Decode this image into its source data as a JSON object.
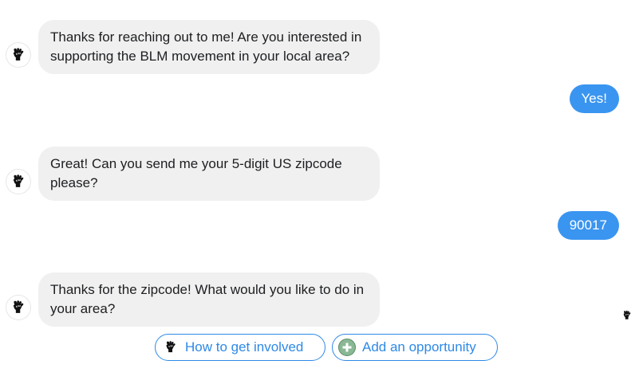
{
  "messages": [
    {
      "from": "bot",
      "text": "Thanks for reaching out to me! Are you interested in supporting the BLM movement in your local area?"
    },
    {
      "from": "user",
      "text": "Yes!"
    },
    {
      "from": "bot",
      "text": "Great! Can you send me your 5-digit US zipcode please?"
    },
    {
      "from": "user",
      "text": "90017"
    },
    {
      "from": "bot",
      "text": "Thanks for the zipcode! What would you like to do in your area?"
    }
  ],
  "quick_replies": [
    {
      "label": "How to get involved",
      "icon": "raised-fist-icon"
    },
    {
      "label": "Add an opportunity",
      "icon": "plus-circle-icon"
    }
  ],
  "colors": {
    "user_bubble": "#3a95f0",
    "bot_bubble": "#f0f0f0",
    "quick_reply_accent": "#2e89e6",
    "plus_icon": "#8ab894"
  }
}
